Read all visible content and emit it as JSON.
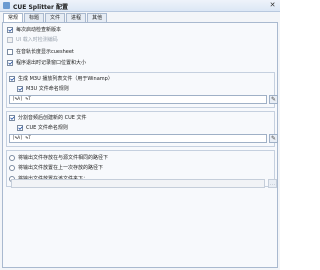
{
  "window": {
    "title": "CUE Splitter 配置",
    "close_glyph": "✕"
  },
  "tabs": [
    "常规",
    "标题",
    "文件",
    "进程",
    "其他"
  ],
  "options": {
    "startup_check": "每次启动检查新版本",
    "load_unicode": "UI 载入时检测编码",
    "always_on_top": "在音轨长度显示cuesheet",
    "remember_position": "程序退出时记录窗口位置和大小",
    "generate_m3u": "生成 M3U 播放列表文件（用于Winamp）",
    "m3u_naming_label": "M3U 文件命名规则",
    "m3u_naming_value": "[%A] %T",
    "generate_cue": "分割音频后创建新的 CUE 文件",
    "cue_naming_label": "CUE 文件命名规则",
    "cue_naming_value": "[%A] %T",
    "radio_same_folder": "将输出文件存放在与源文件相同的路径下",
    "radio_last_folder": "将输出文件放置在上一次存放的路径下",
    "radio_custom_folder": "将输出文件放置在该文件夹下：",
    "custom_folder_value": ""
  },
  "icons": {
    "edit": "✎",
    "browse": "…"
  }
}
